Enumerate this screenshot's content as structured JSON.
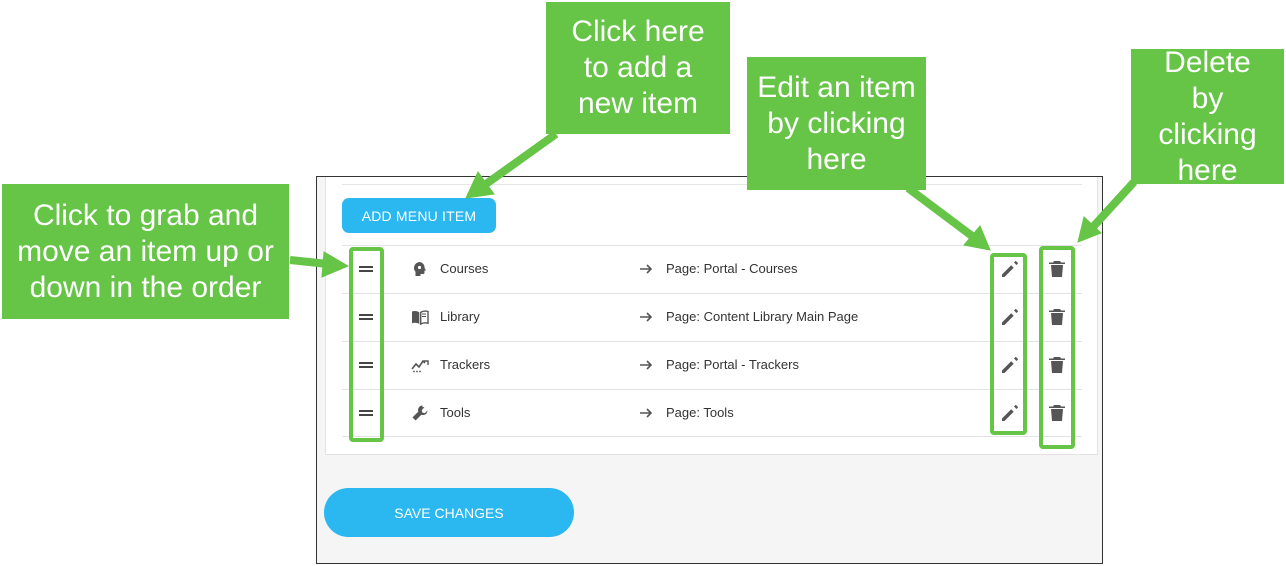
{
  "toolbar": {
    "add_label": "ADD MENU ITEM"
  },
  "menu_items": [
    {
      "icon": "brain-icon",
      "label": "Courses",
      "target": "Page: Portal - Courses"
    },
    {
      "icon": "open-book-icon",
      "label": "Library",
      "target": "Page: Content Library Main Page"
    },
    {
      "icon": "trend-chart-icon",
      "label": "Trackers",
      "target": "Page: Portal - Trackers"
    },
    {
      "icon": "wrench-icon",
      "label": "Tools",
      "target": "Page: Tools"
    }
  ],
  "footer": {
    "save_label": "SAVE CHANGES"
  },
  "annotations": {
    "add": "Click here to add a new item",
    "edit": "Edit an item by clicking here",
    "delete": "Delete by clicking here",
    "drag": "Click to grab and move an item up or down in the order"
  },
  "colors": {
    "accent": "#2bb7f0",
    "callout": "#66c447",
    "icon": "#555555"
  }
}
